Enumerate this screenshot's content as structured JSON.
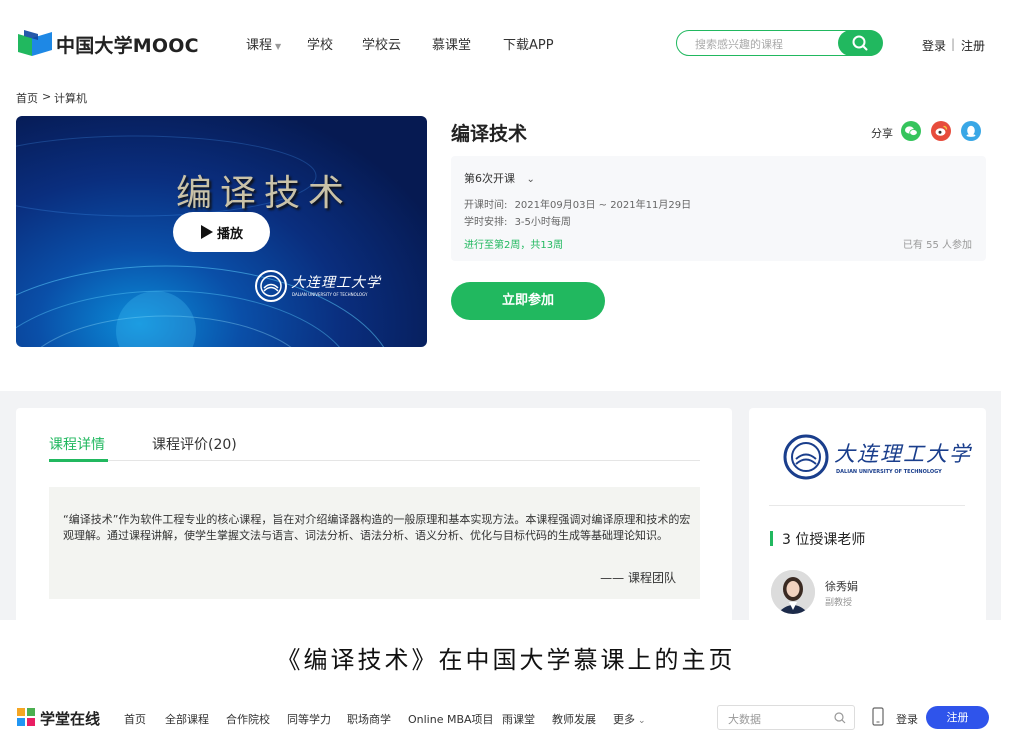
{
  "header": {
    "logo_text": "中国大学MOOC",
    "nav": [
      "课程",
      "学校",
      "学校云",
      "慕课堂",
      "下载APP"
    ],
    "search_placeholder": "搜索感兴趣的课程",
    "login": "登录",
    "separator": "|",
    "register": "注册",
    "brand_color": "#21b85f"
  },
  "breadcrumb": {
    "home": "首页",
    "sep": ">",
    "category": "计算机"
  },
  "cover": {
    "title": "编译技术",
    "play_label": "播放",
    "university_cn": "大连理工大学",
    "university_en": "DALIAN UNIVERSITY OF TECHNOLOGY"
  },
  "course": {
    "title": "编译技术",
    "share_label": "分享",
    "term": "第6次开课",
    "time_label": "开课时间:",
    "time_value": "2021年09月03日 ~ 2021年11月29日",
    "schedule_label": "学时安排:",
    "schedule_value": "3-5小时每周",
    "progress": "进行至第2周，共13周",
    "participants": "已有 55 人参加",
    "join_button": "立即参加"
  },
  "tabs": {
    "details": "课程详情",
    "reviews": "课程评价(20)"
  },
  "description": {
    "text": "“编译技术”作为软件工程专业的核心课程，旨在对介绍编译器构造的一般原理和基本实现方法。本课程强调对编译原理和技术的宏观理解。通过课程讲解，使学生掌握文法与语言、词法分析、语法分析、语义分析、优化与目标代码的生成等基础理论知识。",
    "signature": "—— 课程团队"
  },
  "sidebar": {
    "university_cn": "大连理工大学",
    "university_en": "DALIAN UNIVERSITY OF TECHNOLOGY",
    "teachers_heading": "3 位授课老师",
    "teacher_name": "徐秀娟",
    "teacher_title": "副教授"
  },
  "caption": "《编译技术》在中国大学慕课上的主页",
  "bottom_nav": {
    "logo_text": "学堂在线",
    "items": [
      "首页",
      "全部课程",
      "合作院校",
      "同等学力",
      "职场商学",
      "Online MBA项目",
      "雨课堂",
      "教师发展",
      "更多"
    ],
    "search_placeholder": "大数据",
    "login": "登录",
    "register": "注册",
    "accent_color": "#2f54eb"
  }
}
